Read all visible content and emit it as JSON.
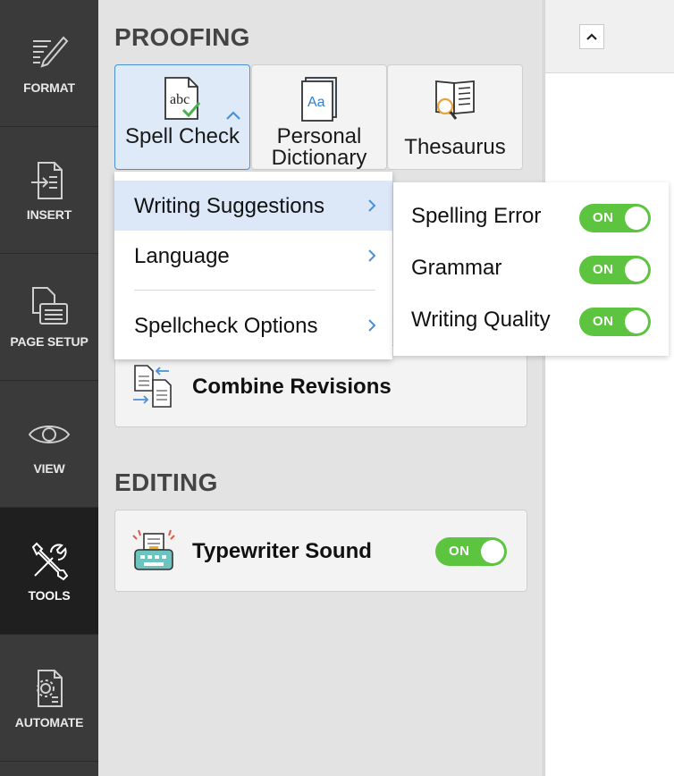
{
  "rail": {
    "items": [
      {
        "label": "FORMAT",
        "icon": "pen-icon"
      },
      {
        "label": "INSERT",
        "icon": "insert-doc-icon"
      },
      {
        "label": "PAGE SETUP",
        "icon": "page-setup-icon"
      },
      {
        "label": "VIEW",
        "icon": "eye-icon"
      },
      {
        "label": "TOOLS",
        "icon": "tools-icon",
        "active": true
      },
      {
        "label": "AUTOMATE",
        "icon": "automate-icon"
      }
    ]
  },
  "proofing": {
    "title": "PROOFING",
    "tiles": [
      {
        "label": "Spell Check",
        "icon": "spell-check-icon",
        "active": true
      },
      {
        "label": "Personal Dictionary",
        "icon": "dictionary-icon"
      },
      {
        "label": "Thesaurus",
        "icon": "thesaurus-icon"
      }
    ],
    "combine_label": "Combine Revisions"
  },
  "editing": {
    "title": "EDITING",
    "typewriter_label": "Typewriter Sound",
    "typewriter_toggle": "ON"
  },
  "spell_menu": {
    "items": [
      {
        "label": "Writing Suggestions",
        "highlight": true
      },
      {
        "label": "Language"
      },
      {
        "label": "Spellcheck Options"
      }
    ]
  },
  "suggestions_menu": {
    "items": [
      {
        "label": "Spelling Error",
        "toggle": "ON"
      },
      {
        "label": "Grammar",
        "toggle": "ON"
      },
      {
        "label": "Writing Quality",
        "toggle": "ON"
      }
    ]
  },
  "colors": {
    "accent": "#4a90d9",
    "toggle_on": "#5cc43f",
    "rail_bg": "#3a3a3a",
    "rail_active": "#1f1f1f"
  }
}
